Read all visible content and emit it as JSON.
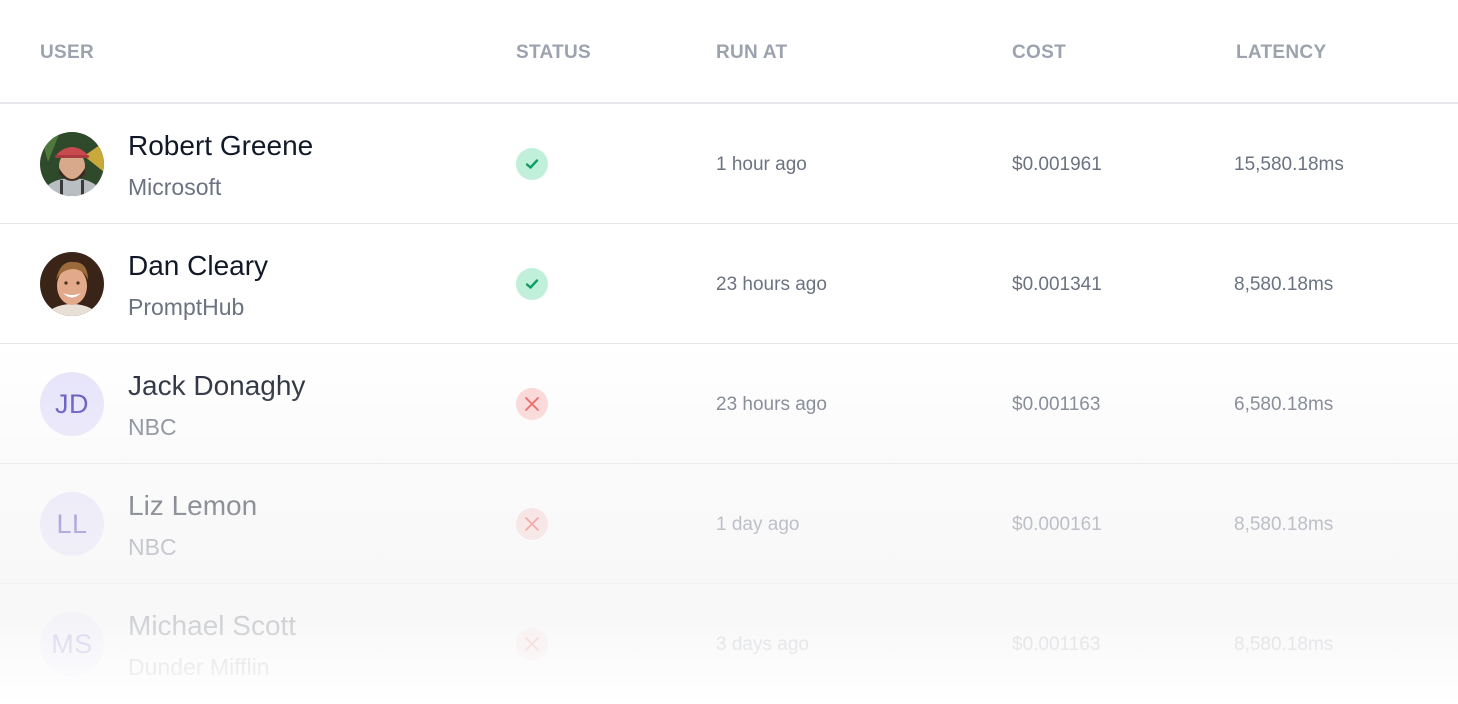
{
  "table": {
    "columns": {
      "user": "USER",
      "status": "STATUS",
      "run_at": "RUN AT",
      "cost": "COST",
      "latency": "LATENCY"
    },
    "rows": [
      {
        "name": "Robert Greene",
        "company": "Microsoft",
        "avatar": "photo",
        "initials": "",
        "status": "success",
        "status_icon": "check-icon",
        "run_at": "1 hour ago",
        "cost": "$0.001961",
        "latency": "15,580.18ms"
      },
      {
        "name": "Dan Cleary",
        "company": "PromptHub",
        "avatar": "photo",
        "initials": "",
        "status": "success",
        "status_icon": "check-icon",
        "run_at": "23 hours ago",
        "cost": "$0.001341",
        "latency": "8,580.18ms"
      },
      {
        "name": "Jack Donaghy",
        "company": "NBC",
        "avatar": "initials",
        "initials": "JD",
        "status": "failed",
        "status_icon": "x-icon",
        "run_at": "23 hours ago",
        "cost": "$0.001163",
        "latency": "6,580.18ms"
      },
      {
        "name": "Liz Lemon",
        "company": "NBC",
        "avatar": "initials",
        "initials": "LL",
        "status": "failed",
        "status_icon": "x-icon",
        "run_at": "1 day ago",
        "cost": "$0.000161",
        "latency": "8,580.18ms"
      },
      {
        "name": "Michael Scott",
        "company": "Dunder Mifflin",
        "avatar": "initials",
        "initials": "MS",
        "status": "failed",
        "status_icon": "x-icon",
        "run_at": "3 days ago",
        "cost": "$0.001163",
        "latency": "8,580.18ms"
      }
    ]
  },
  "colors": {
    "success_bg": "#c1f0da",
    "success_fg": "#0f9d63",
    "fail_bg": "#fbd3d3",
    "fail_fg": "#ef4444",
    "initials_bg": "#e6e3fb",
    "initials_fg": "#4c3fb8"
  }
}
